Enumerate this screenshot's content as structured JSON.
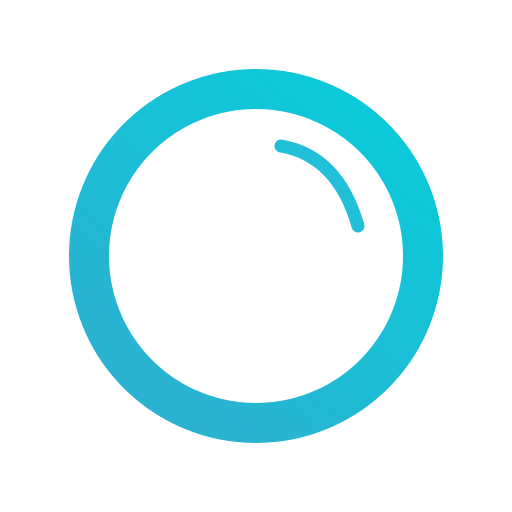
{
  "logo": {
    "icon": "bubble-ring-icon",
    "colors": {
      "background": "#ffffff",
      "ring_gradient_start": "#0cc9da",
      "ring_gradient_end": "#2ab2d1",
      "highlight": "#22bfd8"
    }
  }
}
